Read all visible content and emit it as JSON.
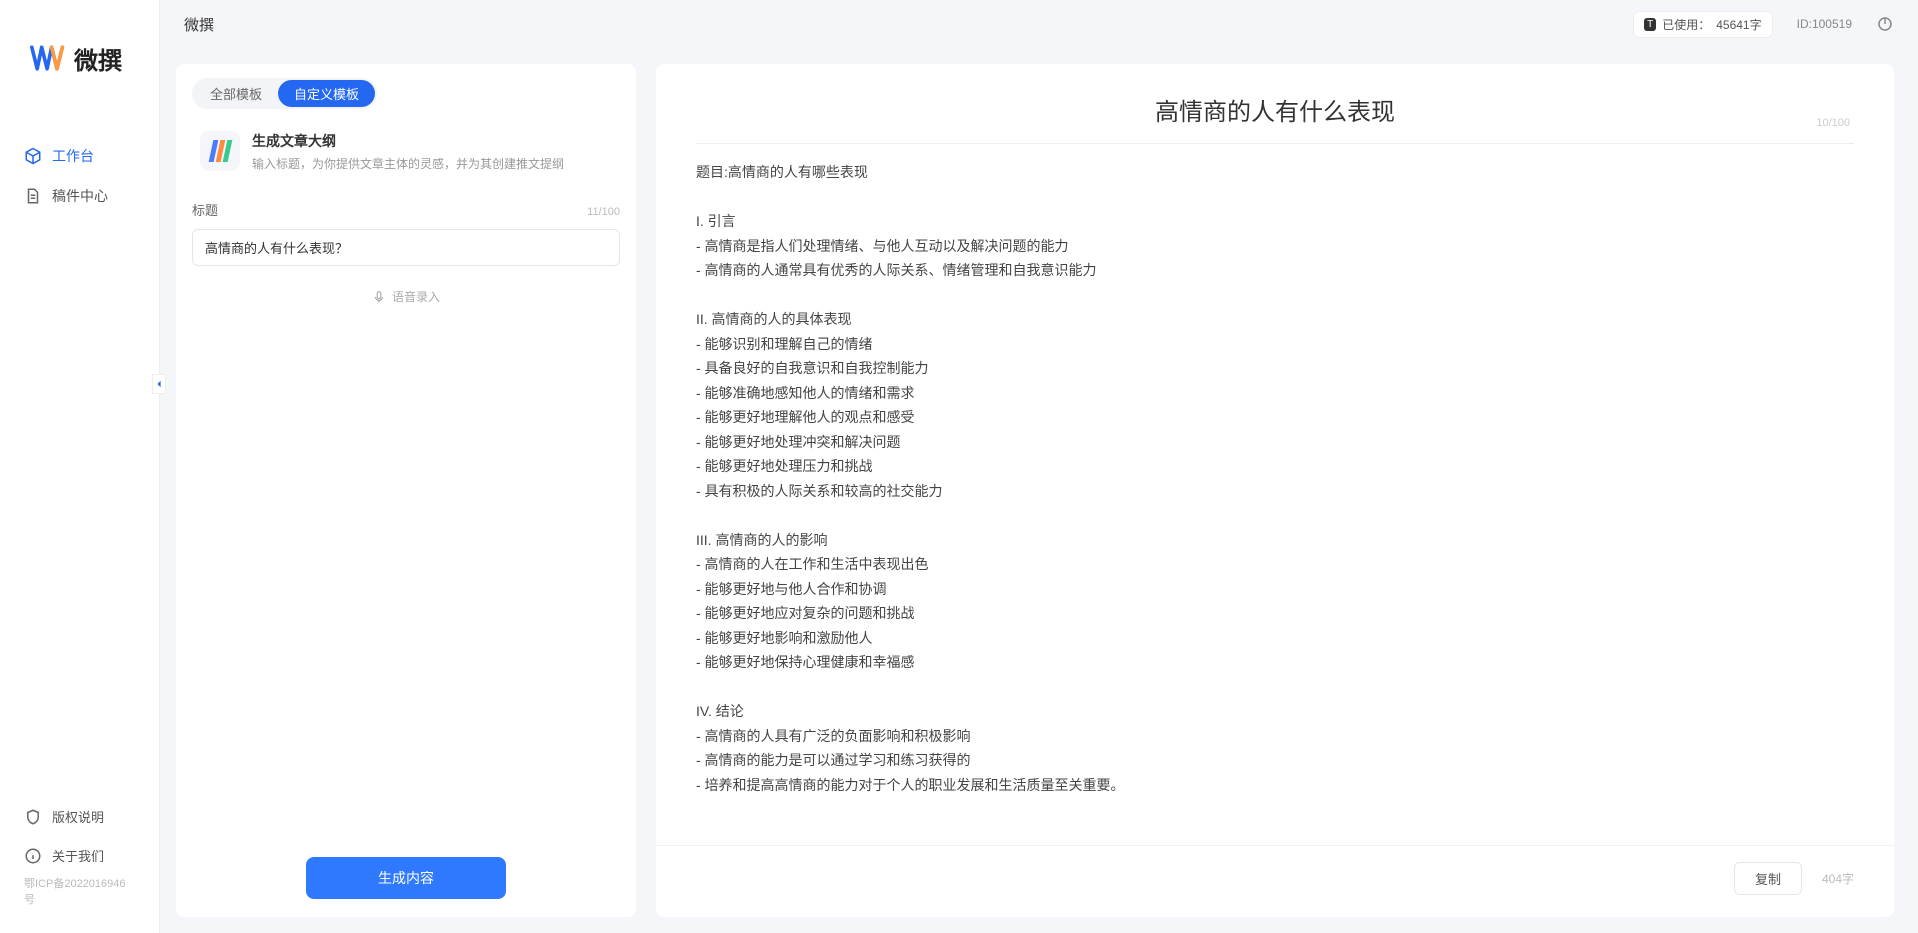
{
  "app": {
    "name": "微撰",
    "topbar_title": "微撰",
    "usage_label": "已使用：",
    "usage_value": "45641字",
    "usage_badge": "T",
    "user_id_label": "ID:",
    "user_id": "100519"
  },
  "sidebar": {
    "items": [
      {
        "label": "工作台",
        "icon": "cube",
        "active": true
      },
      {
        "label": "稿件中心",
        "icon": "file",
        "active": false
      }
    ],
    "bottom": [
      {
        "label": "版权说明",
        "icon": "shield"
      },
      {
        "label": "关于我们",
        "icon": "info"
      }
    ],
    "icp": "鄂ICP备2022016946号"
  },
  "tabs": {
    "all": "全部模板",
    "custom": "自定义模板"
  },
  "template": {
    "title": "生成文章大纲",
    "desc": "输入标题，为你提供文章主体的灵感，并为其创建推文提纲"
  },
  "form": {
    "title_label": "标题",
    "title_count": "11/100",
    "title_value": "高情商的人有什么表现？",
    "voice_label": "语音录入",
    "generate_label": "生成内容"
  },
  "output": {
    "title": "高情商的人有什么表现",
    "title_count": "10/100",
    "body": "题目:高情商的人有哪些表现\n\nI. 引言\n- 高情商是指人们处理情绪、与他人互动以及解决问题的能力\n- 高情商的人通常具有优秀的人际关系、情绪管理和自我意识能力\n\nII. 高情商的人的具体表现\n- 能够识别和理解自己的情绪\n- 具备良好的自我意识和自我控制能力\n- 能够准确地感知他人的情绪和需求\n- 能够更好地理解他人的观点和感受\n- 能够更好地处理冲突和解决问题\n- 能够更好地处理压力和挑战\n- 具有积极的人际关系和较高的社交能力\n\nIII. 高情商的人的影响\n- 高情商的人在工作和生活中表现出色\n- 能够更好地与他人合作和协调\n- 能够更好地应对复杂的问题和挑战\n- 能够更好地影响和激励他人\n- 能够更好地保持心理健康和幸福感\n\nIV. 结论\n- 高情商的人具有广泛的负面影响和积极影响\n- 高情商的能力是可以通过学习和练习获得的\n- 培养和提高高情商的能力对于个人的职业发展和生活质量至关重要。",
    "copy_label": "复制",
    "word_count": "404字"
  }
}
